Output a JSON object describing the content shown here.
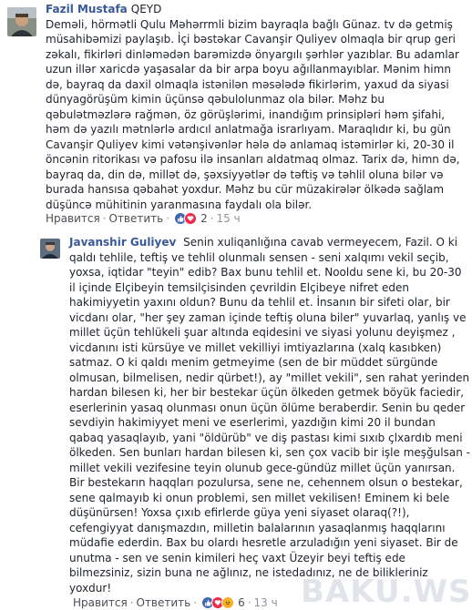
{
  "comments": [
    {
      "author": "Fazil Mustafa",
      "tag": "QEYD",
      "text": "Deməli, hörmətli Qulu Məhərrmli bizim bayraqla bağlı Günaz. tv də getmiş müsahibəmizi paylaşıb. İçi bəstəkar Cavanşir Quliyev olmaqla bir qrup geri zəkalı, fikirləri dinləmədən barəmizdə önyargılı şərhlər yazıblar. Bu adamlar uzun illər xaricdə yaşasalar da bir arpa boyu ağıllanmayıblar. Mənim himn də, bayraq da daxil olmaqla istənilən məsələdə fikirlərim, yaxud da siyasi dünyagörüşüm kimin üçünsə qəbulolunmaz ola bilər. Məhz bu qəbulətməzlərə rağmən, öz görüşlərimi, inandığım prinsipləri həm şifahi, həm də yazılı mətnlərlə ardıcıl anlatmağa israrlıyam. Maraqlıdır ki, bu gün Cavanşir Quliyev kimi vətənşivənlər hələ də anlamaq istəmirlər ki, 20-30 il öncənin ritorikası və pafosu ilə insanları aldatmaq olmaz. Tarix də, himn də, bayraq da, din də, millət də, şəxsiyyətlər də təftiş və təhlil oluna bilər və burada hansısa qəbahət yoxdur. Məhz bu cür müzakirələr ölkədə sağlam düşüncə mühitinin yaranmasına faydalı ola bilər.",
      "like_label": "Нравится",
      "reply_label": "Ответить",
      "reactions_count": "2",
      "time": "15 ч"
    },
    {
      "author": "Javanshir Guliyev",
      "text": "Senin xuliqanlığına cavab vermeyecem, Fazil. O ki qaldı tehlile, teftiş ve tehlil olunmalı sensen - seni xalqımı vekil seçib, yoxsa, iqtidar \"teyin\" edib? Bax bunu tehlil et. Nooldu sene ki, bu 20-30 il içinde Elçibeyin temsilçisinden çevrildin Elçibeye nifret eden hakimiyyetin yaxını oldun? Bunu da tehlil et. İnsanın bir sifeti olar, bir vicdanı olar, \"her şey zaman içinde teftiş oluna biler\" yuvarlaq, yanlış ve millet üçün tehlükeli şuar altında eqidesini ve siyasi yolunu deyişmez , vicdanını isti kürsüye ve millet vekilliyi imtiyazlarına (xalq kasıbken) satmaz. O ki qaldı menim getmeyime (sen de bir müddet sürgünde olmusan, bilmelisen, nedir qürbet!), ay \"millet vekili\", sen rahat yerinden hardan bilesen ki, her bir bestekar üçün ölkeden getmek böyük faciedir, eserlerinin yasaq olunması onun üçün ölüme beraberdir. Senin bu qeder sevdiyin hakimiyyet meni ve eserlerimi, yazdığın kimi 20 il bundan qabaq yasaqlayıb, yani \"öldürüb\" ve diş pastası kimi sıxıb çlxardıb meni ölkeden. Sen bunları hardan bilesen ki, sen çox vacib bir işle meşğulsan - millet vekili vezifesine teyin olunub gece-gündüz millet üçün yanırsan. Bir bestekarın haqqları pozulursa, sene ne, cehennem olsun o bestekar, sene qalmayıb ki onun problemi, sen millet vekilisen! Eminem ki bele düşünürsen! Yoxsa çıxıb efirlerde güya yeni siyaset olaraq(?!), cefengiyyat danışmazdın, milletin balalarının yasaqlanmış haqqlarını müdafie ederdin. Bax bu olardı hesretle arzuladığın yeni siyaset. Bir de unutma - sen ve senin kimileri heç vaxt Üzeyir beyi teftiş ede bilmezsiniz, sizin buna ne ağlınız, ne istedadınız, ne de bilikleriniz yoxdur!",
      "like_label": "Нравится",
      "reply_label": "Ответить",
      "reactions_count": "6",
      "time": "13 ч"
    }
  ],
  "watermark": "BAKU.WS",
  "colors": {
    "author": "#385898",
    "meta": "#90949c",
    "like_reaction": "#4267b2",
    "love_reaction": "#f0284a",
    "angry_reaction": "#f7b125"
  },
  "icons": [
    "like-reaction-icon",
    "love-reaction-icon",
    "angry-reaction-icon"
  ]
}
